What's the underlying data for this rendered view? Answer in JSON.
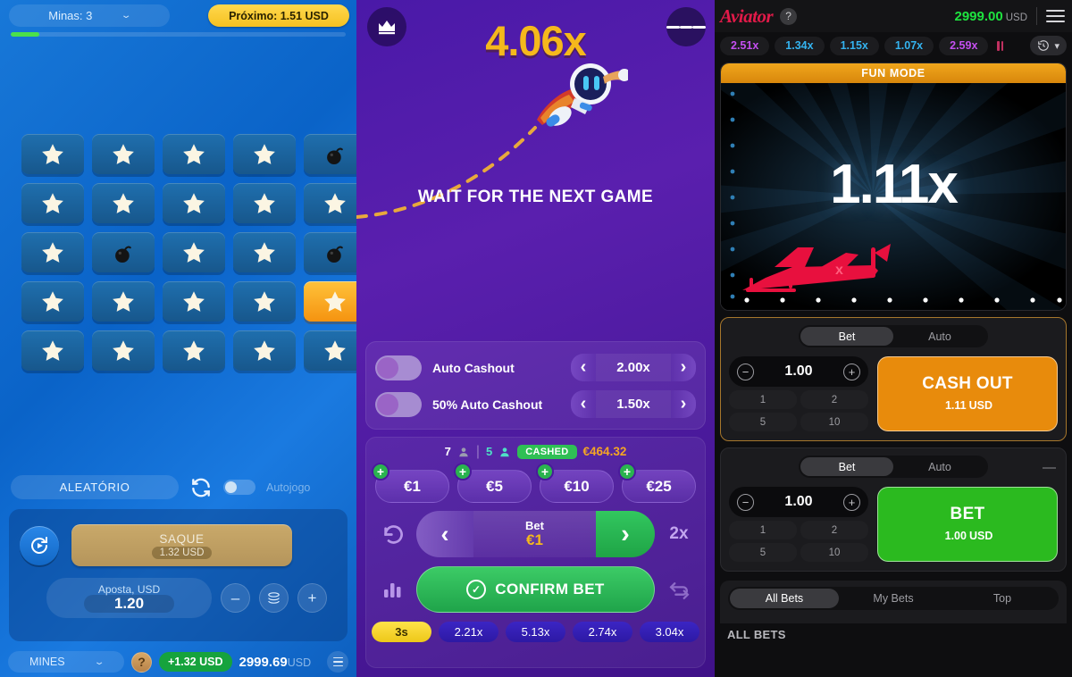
{
  "mines": {
    "minas_label": "Minas: 3",
    "proximo_label": "Próximo: 1.51 USD",
    "progress_pct": 8,
    "grid": [
      [
        "star",
        "star",
        "star",
        "star",
        "bomb"
      ],
      [
        "star",
        "star",
        "star",
        "star",
        "star"
      ],
      [
        "star",
        "bomb",
        "star",
        "star",
        "bomb"
      ],
      [
        "star",
        "star",
        "star",
        "star",
        "star-gold"
      ],
      [
        "star",
        "star",
        "star",
        "star",
        "star"
      ]
    ],
    "random_label": "ALEATÓRIO",
    "autoplay_label": "Autojogo",
    "autoplay_on": false,
    "cashout_label": "SAQUE",
    "cashout_value": "1.32 USD",
    "stake_label": "Aposta, USD",
    "stake_value": "1.20",
    "minus_label": "–",
    "plus_label": "+",
    "game_select": "MINES",
    "help_label": "?",
    "win_badge": "+1.32 USD",
    "balance": "2999.69",
    "balance_currency": "USD"
  },
  "crash": {
    "multiplier": "4.06x",
    "status_text": "WAIT FOR THE NEXT GAME",
    "auto_cashout": {
      "label": "Auto Cashout",
      "value": "2.00x",
      "enabled": false
    },
    "auto_cashout_50": {
      "label": "50% Auto Cashout",
      "value": "1.50x",
      "enabled": false
    },
    "players_total": "7",
    "players_cashed": "5",
    "cashed_label": "CASHED",
    "cashed_amount": "€464.32",
    "quick_chips": [
      "€1",
      "€5",
      "€10",
      "€25"
    ],
    "chip_plus": "+",
    "bet_label": "Bet",
    "bet_value": "€1",
    "double_label": "2x",
    "confirm_label": "CONFIRM BET",
    "history": [
      "3s",
      "2.21x",
      "5.13x",
      "2.74x",
      "3.04x"
    ]
  },
  "aviator": {
    "logo": "Aviator",
    "help": "?",
    "balance": "2999.00",
    "currency": "USD",
    "history": [
      {
        "value": "2.51x",
        "color": "purple"
      },
      {
        "value": "1.34x",
        "color": "blue"
      },
      {
        "value": "1.15x",
        "color": "blue"
      },
      {
        "value": "1.07x",
        "color": "blue"
      },
      {
        "value": "2.59x",
        "color": "purple"
      }
    ],
    "fun_mode": "FUN MODE",
    "current_multiplier": "1.11x",
    "panel_one": {
      "tab_bet": "Bet",
      "tab_auto": "Auto",
      "active_tab": "Bet",
      "amount": "1.00",
      "minus": "−",
      "plus": "+",
      "quick": [
        "1",
        "2",
        "5",
        "10"
      ],
      "action_title": "CASH OUT",
      "action_amount": "1.11",
      "action_currency": "USD"
    },
    "panel_two": {
      "tab_bet": "Bet",
      "tab_auto": "Auto",
      "active_tab": "Bet",
      "amount": "1.00",
      "minus": "−",
      "plus": "+",
      "quick": [
        "1",
        "2",
        "5",
        "10"
      ],
      "action_title": "BET",
      "action_amount": "1.00",
      "action_currency": "USD",
      "collapse": "—"
    },
    "bets_tabs": [
      "All Bets",
      "My Bets",
      "Top"
    ],
    "bets_active_tab": "All Bets",
    "bets_caption": "ALL BETS"
  },
  "colors": {
    "mines_accent": "#f5a623",
    "crash_accent": "#f5b81c",
    "aviator_red": "#e21a49",
    "aviator_green": "#1ee33f",
    "cashout_orange": "#e88b0c",
    "bet_green": "#2bba1f"
  }
}
